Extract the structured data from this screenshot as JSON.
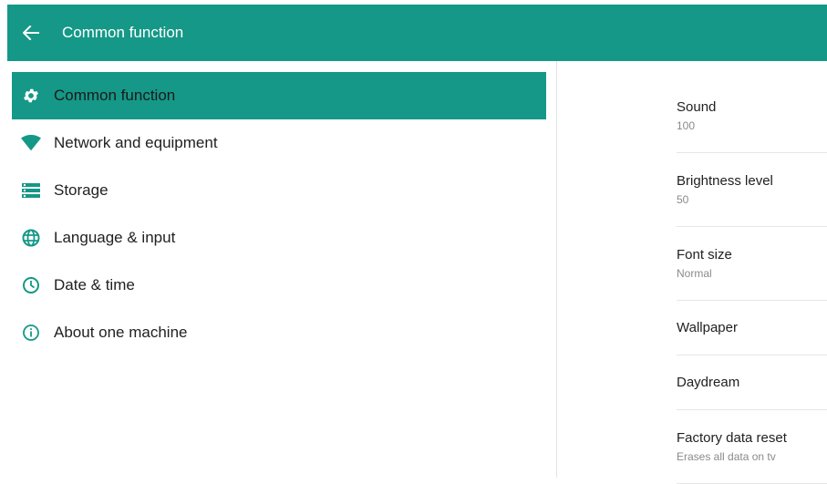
{
  "appbar": {
    "title": "Common function",
    "back_icon": "arrow-left-icon",
    "color": "#159887"
  },
  "sidebar": {
    "items": [
      {
        "label": "Common function",
        "icon": "gear-icon",
        "active": true
      },
      {
        "label": "Network and equipment",
        "icon": "wifi-icon",
        "active": false
      },
      {
        "label": "Storage",
        "icon": "storage-icon",
        "active": false
      },
      {
        "label": "Language & input",
        "icon": "globe-icon",
        "active": false
      },
      {
        "label": "Date & time",
        "icon": "clock-icon",
        "active": false
      },
      {
        "label": "About one machine",
        "icon": "info-icon",
        "active": false
      }
    ]
  },
  "settings": {
    "items": [
      {
        "title": "Sound",
        "summary": "100"
      },
      {
        "title": "Brightness level",
        "summary": "50"
      },
      {
        "title": "Font size",
        "summary": "Normal"
      },
      {
        "title": "Wallpaper"
      },
      {
        "title": "Daydream"
      },
      {
        "title": "Factory data reset",
        "summary": "Erases all data on tv"
      }
    ]
  },
  "colors": {
    "accent": "#159887",
    "icon": "#159887"
  }
}
